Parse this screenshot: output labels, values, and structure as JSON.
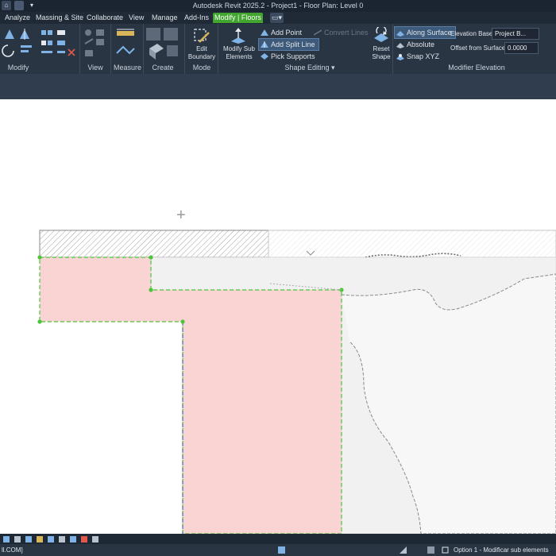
{
  "app": {
    "title": "Autodesk Revit 2025.2 - Project1 - Floor Plan: Level 0"
  },
  "quick_access": {
    "home_glyph": "⌂",
    "down_glyph": "▾"
  },
  "menu": {
    "tabs": [
      "Analyze",
      "Massing & Site",
      "Collaborate",
      "View",
      "Manage",
      "Add-Ins",
      "Modify | Floors"
    ],
    "active_tab": "Modify | Floors",
    "extra_glyph": "▭▾"
  },
  "ribbon": {
    "panels": {
      "modify": "Modify",
      "view": "View",
      "measure": "Measure",
      "create": "Create",
      "mode": "Mode",
      "shape_editing": "Shape Editing ▾",
      "modifier_elevation": "Modifier Elevation"
    },
    "mode": {
      "edit_boundary_label": "Edit Boundary"
    },
    "shape_editing": {
      "modify_sub_elements_label": "Modify Sub Elements",
      "add_point": "Add Point",
      "add_split_line": "Add Split Line",
      "pick_supports": "Pick Supports",
      "convert_lines": "Convert Lines",
      "reset_shape_label": "Reset Shape"
    },
    "elevation": {
      "along_surface": "Along Surface",
      "absolute": "Absolute",
      "snap_xyz": "Snap XYZ",
      "elevation_base_label": "Elevation Base:",
      "elevation_base_value": "Project B...",
      "offset_label": "Offset from Surface:",
      "offset_value": "0.0000"
    }
  },
  "canvas": {
    "cursor_glyph": "+"
  },
  "status": {
    "left_text": "ll.COM]",
    "option_text": "Option 1 - Modificar sub elements"
  },
  "colors": {
    "active_tab": "#41a52f",
    "selected_region": "#fad4d2",
    "boundary_green": "#4dc43a",
    "hatch": "#d6d6d6",
    "surface": "#f1f1f1"
  }
}
